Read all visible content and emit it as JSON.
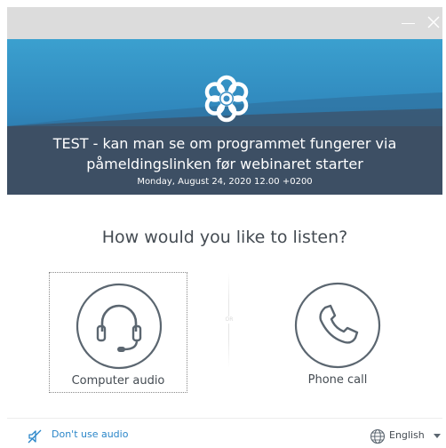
{
  "window": {
    "minimize_icon": "minimize-icon",
    "close_icon": "close-icon"
  },
  "banner": {
    "logo_icon": "flower-logo-icon",
    "meeting_title": "TEST - kan man se om programmet fungerer via påmeldingslinken før webinaret starter",
    "meeting_date": "Monday, August 24, 2020   12.00 +0200"
  },
  "main": {
    "question": "How would you like to listen?",
    "options": [
      {
        "label": "Computer audio",
        "icon": "headset-icon",
        "selected": true
      },
      {
        "label": "Phone call",
        "icon": "phone-icon",
        "selected": false
      }
    ],
    "separator_text": "OR"
  },
  "footer": {
    "no_audio_label": "Don't use audio",
    "no_audio_icon": "muted-speaker-icon",
    "language": "English",
    "language_icon": "globe-icon"
  },
  "colors": {
    "banner_top": "#3ba0cf",
    "banner_bottom": "#3d4f64",
    "link": "#2a86c9",
    "text": "#444b52"
  }
}
